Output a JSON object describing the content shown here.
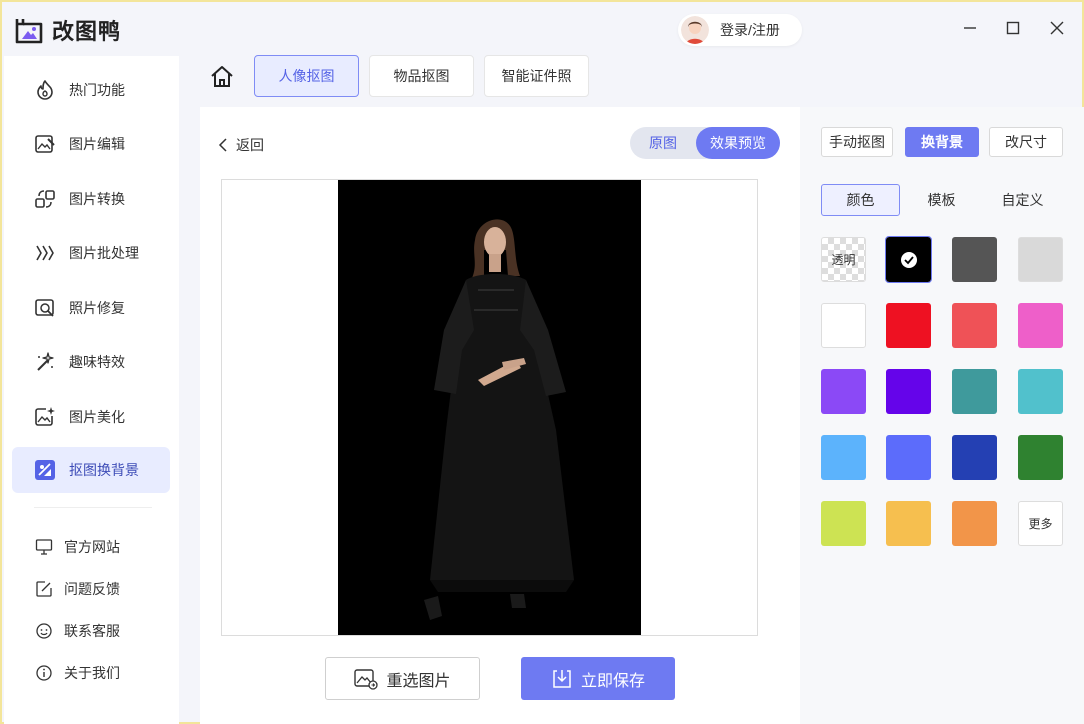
{
  "app": {
    "title": "改图鸭"
  },
  "header": {
    "login_label": "登录/注册"
  },
  "sidebar": {
    "items": [
      {
        "label": "热门功能",
        "icon": "flame-icon"
      },
      {
        "label": "图片编辑",
        "icon": "image-edit-icon"
      },
      {
        "label": "图片转换",
        "icon": "convert-icon"
      },
      {
        "label": "图片批处理",
        "icon": "batch-icon"
      },
      {
        "label": "照片修复",
        "icon": "photo-repair-icon"
      },
      {
        "label": "趣味特效",
        "icon": "magic-wand-icon"
      },
      {
        "label": "图片美化",
        "icon": "sparkle-image-icon"
      },
      {
        "label": "抠图换背景",
        "icon": "cutout-icon",
        "active": true
      }
    ],
    "links": [
      {
        "label": "官方网站",
        "icon": "monitor-icon"
      },
      {
        "label": "问题反馈",
        "icon": "feedback-icon"
      },
      {
        "label": "联系客服",
        "icon": "customer-service-icon"
      },
      {
        "label": "关于我们",
        "icon": "info-icon"
      }
    ]
  },
  "tabs": [
    {
      "label": "人像抠图",
      "active": true
    },
    {
      "label": "物品抠图"
    },
    {
      "label": "智能证件照"
    }
  ],
  "main": {
    "back_label": "返回",
    "toggle": {
      "original": "原图",
      "preview": "效果预览",
      "selected": "效果预览"
    },
    "reselect_label": "重选图片",
    "save_label": "立即保存"
  },
  "right": {
    "modes": [
      {
        "label": "手动抠图"
      },
      {
        "label": "换背景",
        "active": true
      },
      {
        "label": "改尺寸"
      }
    ],
    "subtabs": [
      {
        "label": "颜色",
        "active": true
      },
      {
        "label": "模板"
      },
      {
        "label": "自定义"
      }
    ],
    "transparent_label": "透明",
    "more_label": "更多",
    "swatches": [
      "transparent",
      "#000000",
      "#555555",
      "#d9d9d9",
      "#ffffff",
      "#ee1122",
      "#ef5257",
      "#ee5fc9",
      "#8b49f6",
      "#6504ea",
      "#3f9a9c",
      "#51c1cc",
      "#5cb3fc",
      "#5c6cfb",
      "#2440b3",
      "#2f8230",
      "#cde353",
      "#f6bf4f",
      "#f29549",
      "more"
    ],
    "selected_swatch": "#000000"
  },
  "colors": {
    "accent": "#6e7af2",
    "active_bg": "#e8ecff"
  }
}
